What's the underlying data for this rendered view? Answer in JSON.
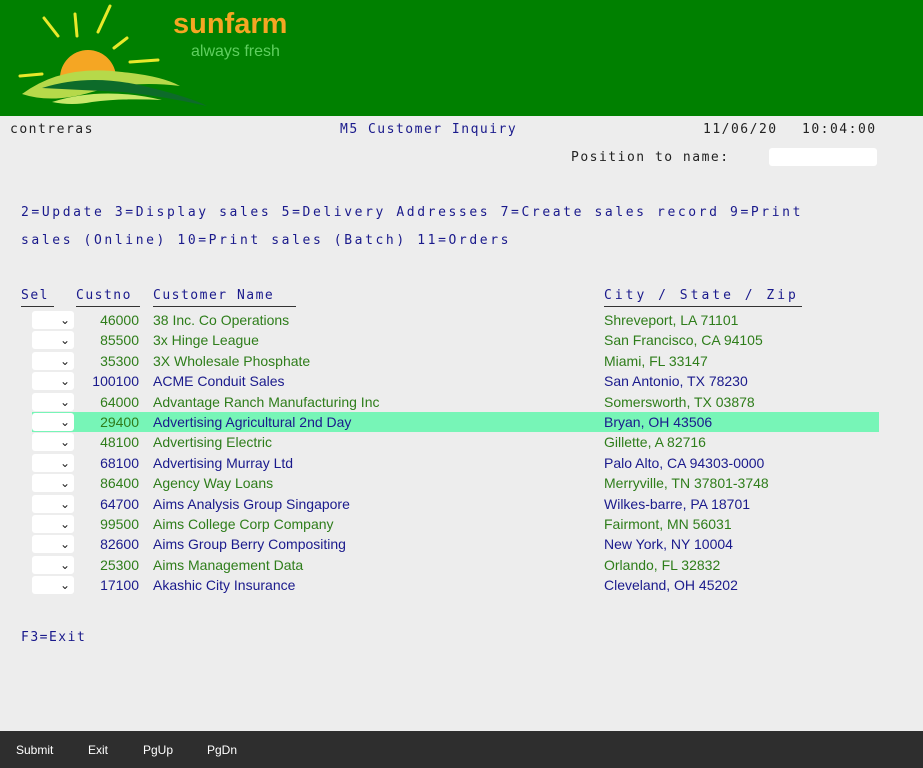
{
  "brand": {
    "name": "sunfarm",
    "tagline": "always fresh"
  },
  "status_bar": {
    "user": "contreras",
    "title": "M5 Customer Inquiry",
    "date": "11/06/20",
    "time": "10:04:00"
  },
  "position": {
    "label": "Position to name:",
    "value": ""
  },
  "options": {
    "line1": "2=Update 3=Display sales 5=Delivery Addresses 7=Create sales record 9=Print",
    "line2": "sales (Online) 10=Print sales (Batch) 11=Orders"
  },
  "columns": {
    "sel": "Sel",
    "custno": "Custno",
    "name": "Customer Name",
    "city": "City / State / Zip"
  },
  "rows": [
    {
      "custno": "46000",
      "name": "38 Inc. Co Operations",
      "city": "Shreveport, LA 71101"
    },
    {
      "custno": "85500",
      "name": "3x Hinge League",
      "city": "San Francisco, CA 94105"
    },
    {
      "custno": "35300",
      "name": "3X Wholesale Phosphate",
      "city": "Miami, FL 33147"
    },
    {
      "custno": "100100",
      "name": "ACME Conduit Sales",
      "city": "San Antonio, TX 78230"
    },
    {
      "custno": "64000",
      "name": "Advantage Ranch Manufacturing Inc",
      "city": "Somersworth, TX 03878"
    },
    {
      "custno": "29400",
      "name": "Advertising Agricultural 2nd Day",
      "city": "Bryan, OH 43506"
    },
    {
      "custno": "48100",
      "name": "Advertising Electric",
      "city": "Gillette, A 82716"
    },
    {
      "custno": "68100",
      "name": "Advertising Murray Ltd",
      "city": "Palo Alto, CA 94303-0000"
    },
    {
      "custno": "86400",
      "name": "Agency Way Loans",
      "city": "Merryville, TN 37801-3748"
    },
    {
      "custno": "64700",
      "name": "Aims Analysis Group Singapore",
      "city": "Wilkes-barre, PA 18701"
    },
    {
      "custno": "99500",
      "name": "Aims College Corp Company",
      "city": "Fairmont, MN 56031"
    },
    {
      "custno": "82600",
      "name": "Aims Group Berry Compositing",
      "city": "New York, NY 10004"
    },
    {
      "custno": "25300",
      "name": "Aims Management Data",
      "city": "Orlando, FL 32832"
    },
    {
      "custno": "17100",
      "name": "Akashic City Insurance",
      "city": "Cleveland, OH 45202"
    }
  ],
  "exit_hint": "F3=Exit",
  "footer": {
    "submit": "Submit",
    "exit": "Exit",
    "pgup": "PgUp",
    "pgdn": "PgDn"
  },
  "colors": {
    "header_bg": "#008000",
    "highlight": "#77f5b7",
    "green_text": "#2e7d1a",
    "navy_text": "#1a1a8c",
    "footer_bg": "#2e2e2e"
  }
}
